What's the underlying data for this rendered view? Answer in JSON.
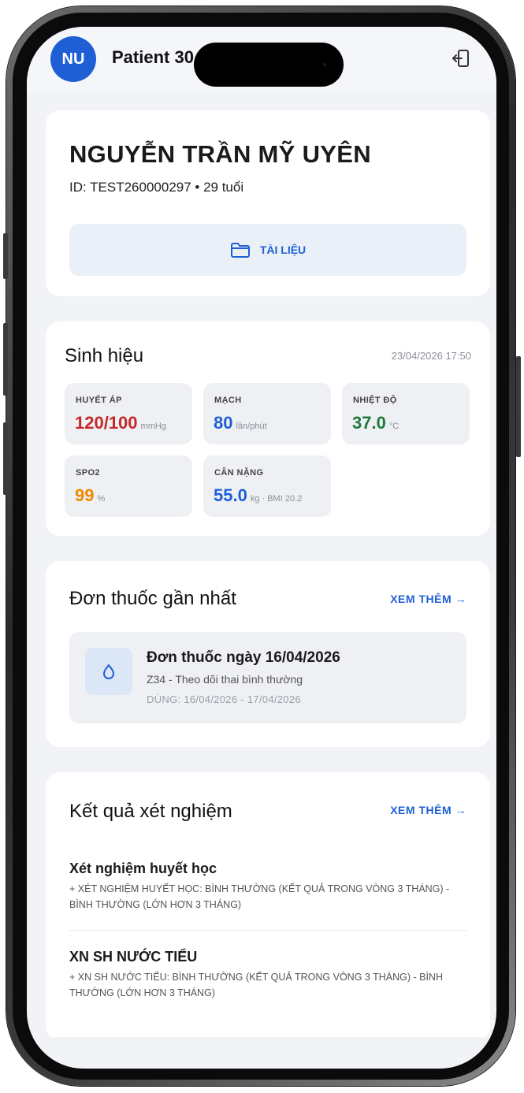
{
  "header": {
    "avatar_initials": "NU",
    "title": "Patient 30",
    "logout_icon": "logout-icon"
  },
  "patient": {
    "name": "NGUYỄN TRẦN MỸ UYÊN",
    "id_line": "ID: TEST260000297 • 29 tuổi",
    "documents_label": "TÀI LIỆU"
  },
  "vitals": {
    "title": "Sinh hiệu",
    "timestamp": "23/04/2026 17:50",
    "items": [
      {
        "label": "HUYẾT ÁP",
        "value": "120/100",
        "unit": "mmHg",
        "color": "#c62828"
      },
      {
        "label": "MẠCH",
        "value": "80",
        "unit": "lần/phút",
        "color": "#1f5fd6"
      },
      {
        "label": "NHIỆT ĐỘ",
        "value": "37.0",
        "unit": "°C",
        "color": "#1e7a3c"
      },
      {
        "label": "SPO2",
        "value": "99",
        "unit": "%",
        "color": "#ef8a00"
      },
      {
        "label": "CÂN NẶNG",
        "value": "55.0",
        "unit": "kg · BMI 20.2",
        "color": "#1f5fd6"
      }
    ]
  },
  "prescription": {
    "title": "Đơn thuốc gần nhất",
    "more_label": "XEM THÊM →",
    "latest": {
      "title": "Đơn thuốc ngày 16/04/2026",
      "diagnosis": "Z34 - Theo dõi thai bình thường",
      "dates": "DÙNG: 16/04/2026 - 17/04/2026"
    }
  },
  "lab_results": {
    "title": "Kết quả xét nghiệm",
    "more_label": "XEM THÊM →",
    "items": [
      {
        "name": "Xét nghiệm huyết học",
        "desc": "+ XÉT NGHIỆM HUYẾT HỌC: BÌNH THƯỜNG (KẾT QUẢ TRONG VÒNG 3 THÁNG) - BÌNH THƯỜNG (LỚN HƠN 3 THÁNG)"
      },
      {
        "name": "XN SH NƯỚC TIỂU",
        "desc": "+ XN SH NƯỚC TIỂU: BÌNH THƯỜNG (KẾT QUẢ TRONG VÒNG 3 THÁNG) - BÌNH THƯỜNG (LỚN HƠN 3 THÁNG)"
      }
    ]
  }
}
